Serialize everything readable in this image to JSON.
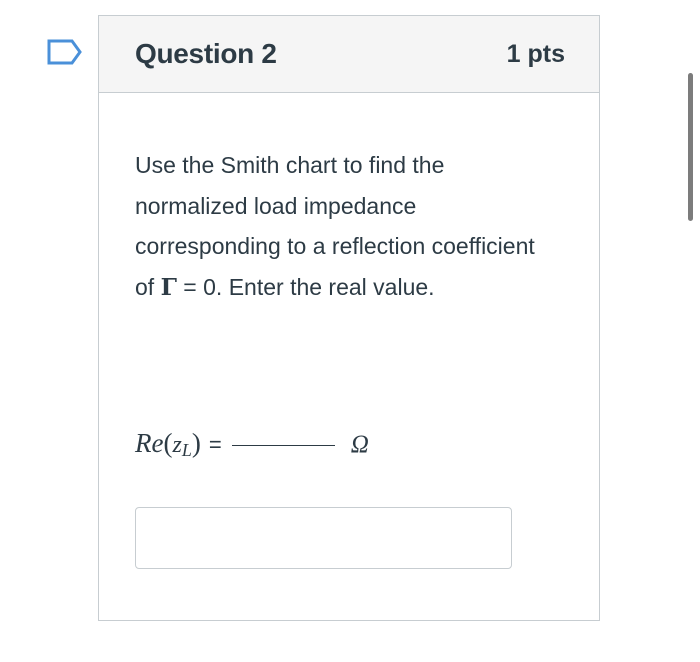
{
  "question": {
    "title": "Question 2",
    "points": "1 pts",
    "text_before": "Use the Smith chart to find the normalized load impedance corresponding to a reflection coefficient of ",
    "gamma_symbol": "Γ",
    "text_after": " = 0. Enter the real value."
  },
  "formula": {
    "re": "Re",
    "open_paren": "(",
    "z": "z",
    "subscript": "L",
    "close_paren": ")",
    "equals": "=",
    "unit": "Ω"
  },
  "answer": {
    "value": "",
    "placeholder": ""
  },
  "icons": {
    "flag": "flag-bookmark-icon"
  },
  "colors": {
    "accent": "#4a90d9",
    "text": "#2d3b45",
    "border": "#c7cdd1",
    "header_bg": "#f5f5f5"
  }
}
